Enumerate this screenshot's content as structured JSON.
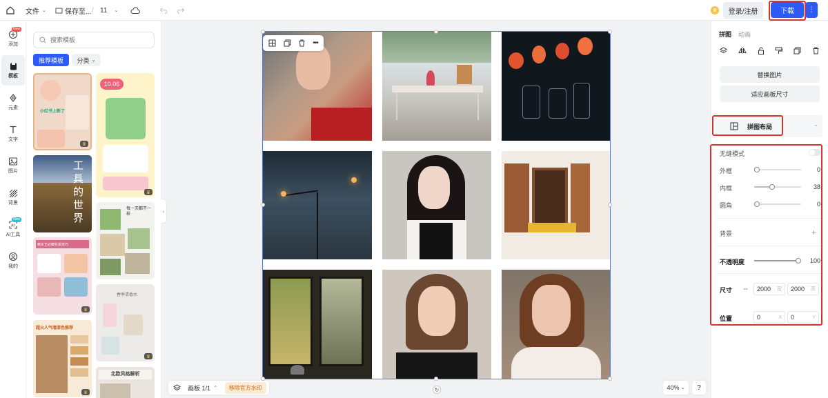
{
  "topbar": {
    "file_menu": "文件",
    "save_status": "保存至...",
    "separator": "/",
    "doc_name": "11",
    "login_label": "登录/注册",
    "download_label": "下载",
    "more_label": "⋮"
  },
  "leftnav": {
    "items": [
      {
        "label": "添加",
        "icon": "add-icon",
        "badge": "New"
      },
      {
        "label": "模板",
        "icon": "template-icon"
      },
      {
        "label": "元素",
        "icon": "element-icon"
      },
      {
        "label": "文字",
        "icon": "text-icon"
      },
      {
        "label": "图片",
        "icon": "image-icon"
      },
      {
        "label": "背景",
        "icon": "background-icon"
      },
      {
        "label": "AI工具",
        "icon": "ai-tools-icon",
        "badge": "New"
      },
      {
        "label": "我的",
        "icon": "user-icon"
      }
    ]
  },
  "templates": {
    "search_placeholder": "搜索模板",
    "chip_recommended": "推荐模板",
    "chip_category": "分类",
    "items": [
      {
        "title": "小红书上新了",
        "color": "#f0d9c8"
      },
      {
        "title": "10.06",
        "color": "#fff3c9"
      },
      {
        "title": "工具的世界",
        "color": "#6b86a8"
      },
      {
        "title": "每一天都不一样",
        "color": "#f2f2ee"
      },
      {
        "title": "韩女王必藏化妆技巧",
        "color": "#f6dfe3"
      },
      {
        "title": "春季清香水",
        "color": "#ecebea"
      },
      {
        "title": "超火人气墙漆色推荐",
        "color": "#f7ead6"
      },
      {
        "title": "北欧风格解析",
        "color": "#e9e4de"
      }
    ]
  },
  "canvas": {
    "board_label": "画板 1/1",
    "watermark_label": "移除官方水印",
    "zoom": "40%",
    "help": "?"
  },
  "rightpanel": {
    "tab_collage": "拼图",
    "tab_animation": "动画",
    "replace_image": "替换图片",
    "fit_board": "适应画板尺寸",
    "layout_label": "拼图布局",
    "seamless_label": "无缝模式",
    "outer_label": "外框",
    "outer_value": "0",
    "inner_label": "内框",
    "inner_value": "38",
    "corner_label": "圆角",
    "corner_value": "0",
    "background_label": "背景",
    "opacity_label": "不透明度",
    "opacity_value": "100",
    "size_label": "尺寸",
    "width_value": "2000",
    "height_value": "2000",
    "width_unit": "宽",
    "height_unit": "高",
    "position_label": "位置",
    "x_value": "0",
    "y_value": "0",
    "x_unit": "X",
    "y_unit": "Y"
  },
  "colors": {
    "accent": "#2c5bf5",
    "highlight_box": "#d9332f"
  }
}
